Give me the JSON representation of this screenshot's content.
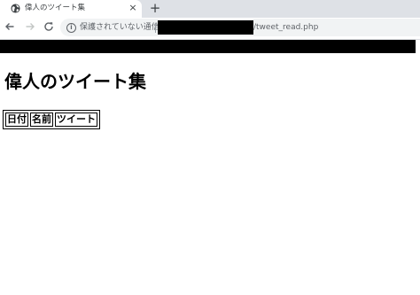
{
  "browser": {
    "tab_title": "偉人のツイート集",
    "tab_close": "×",
    "new_tab": "+",
    "icons": {
      "favicon": "globe-icon",
      "back": "arrow-left-icon",
      "forward": "arrow-right-icon",
      "reload": "reload-icon",
      "info": "info-icon"
    },
    "security_label": "保護されていない通信",
    "url_path": "/tweet_read.php"
  },
  "page": {
    "heading": "偉人のツイート集",
    "table": {
      "headers": [
        "日付",
        "名前",
        "ツイート"
      ]
    }
  }
}
